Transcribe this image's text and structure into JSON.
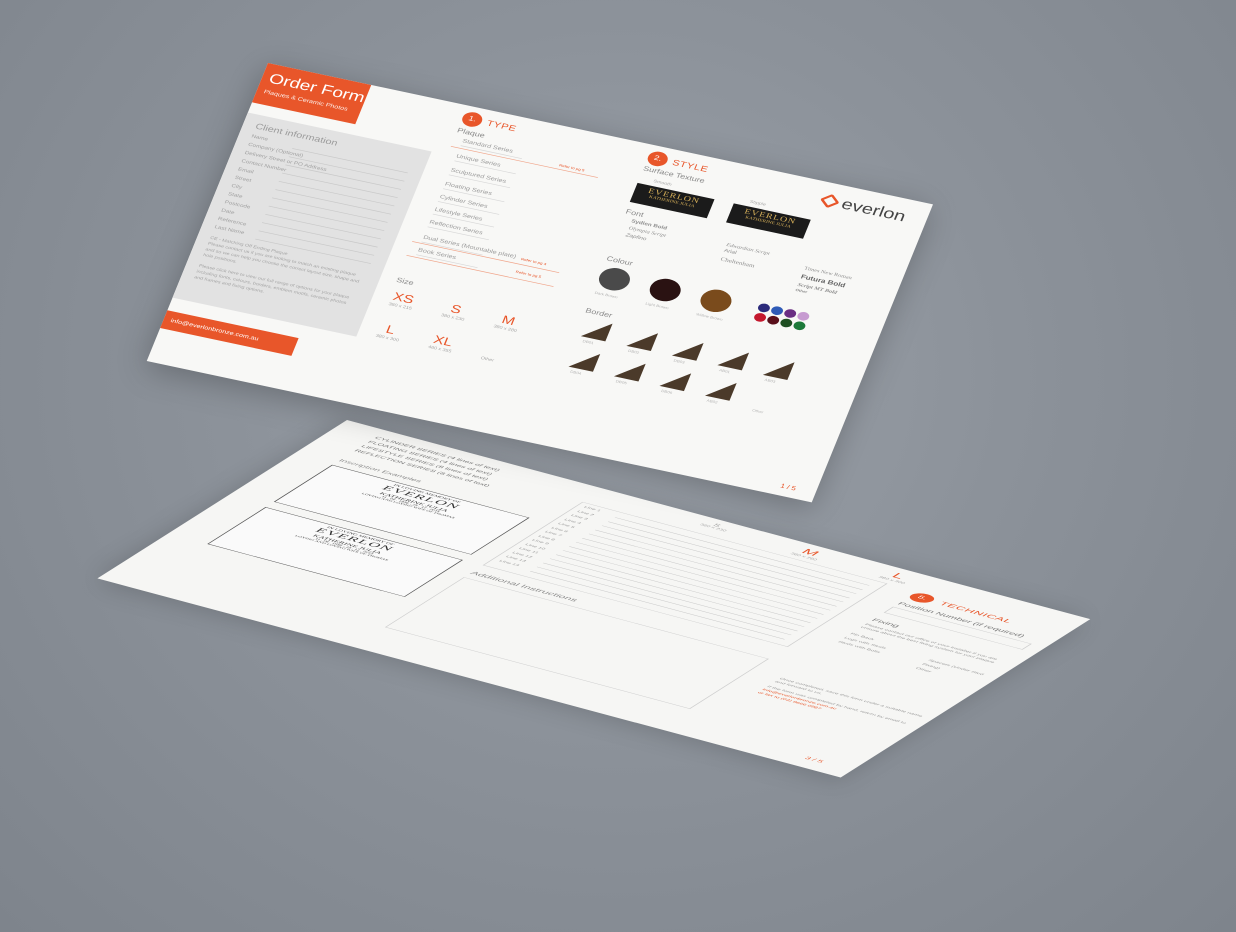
{
  "front": {
    "header": {
      "title": "Order Form",
      "subtitle": "Plaques & Ceramic Photos"
    },
    "client": {
      "title": "Client information",
      "fields": [
        "Name",
        "Company (Optional)",
        "Delivery Street or PO Address",
        "Contact Number",
        "Email",
        "Street",
        "City",
        "State",
        "Postcode",
        "Date",
        "Reference",
        "Last Name"
      ],
      "note1": "CE - Matching Off Ending Plaque",
      "note2": "Please contact us if you are looking to match an existing plaque and so we can help you choose the correct layout size, shape and hole positions.",
      "note3": "Please click here to view our full range of options for your plaque including fonts, colours, borders, emblem motifs, ceramic photos and frames and fixing options."
    },
    "footer": "info@everlonbronze.com.au",
    "type": {
      "num": "1.",
      "title": "TYPE",
      "plaque": "Plaque",
      "series": [
        "Standard Series",
        "Unique Series",
        "Sculptured Series",
        "Floating Series",
        "Cylinder Series",
        "Lifestyle Series",
        "Reflection Series",
        "Dual Series (Mountable plate)",
        "Book Series"
      ],
      "refer1": "Refer to pg 5",
      "refer2": "Refer to pg 4",
      "refer3": "Refer to pg 5"
    },
    "size": {
      "title": "Size",
      "items": [
        {
          "l": "XS",
          "d": "380 x 215"
        },
        {
          "l": "S",
          "d": "380 x 230"
        },
        {
          "l": "M",
          "d": "380 x 280"
        },
        {
          "l": "L",
          "d": "380 x 300"
        },
        {
          "l": "XL",
          "d": "460 x 355"
        }
      ],
      "other": "Other"
    },
    "style": {
      "num": "2.",
      "title": "STYLE",
      "surface": "Surface Texture",
      "smooth": "Smooth",
      "stipple": "Stipple",
      "plaque_l1": "EVERLON",
      "plaque_l2": "KATHERINE JULIA",
      "font_title": "Font",
      "fonts": [
        "Sydlen Bold",
        "Olympia Script",
        "Zapfino",
        "Edwardian Script",
        "Arial",
        "Cheltenham",
        "Times New Roman",
        "Futura Bold",
        "Script MT Bold",
        "Other"
      ],
      "colour_title": "Colour",
      "colours": [
        {
          "name": "Dark Brown",
          "hex": "#4a4a4a"
        },
        {
          "name": "Light Brown",
          "hex": "#2a1212"
        },
        {
          "name": "Willow Brown",
          "hex": "#7a4b1c"
        }
      ],
      "extra_colours": [
        "#2b2a7a",
        "#2f5bb7",
        "#6a2e83",
        "#c79bd1",
        "#c4182d",
        "#5a0f1a",
        "#1f4f22",
        "#1d7a3a"
      ],
      "border_title": "Border",
      "borders": [
        "DB01",
        "DB02",
        "DB03",
        "AB01",
        "AB03",
        "DB04",
        "DB05",
        "DB06",
        "AB02",
        "Other"
      ]
    },
    "brand": "everlon",
    "page": "1 / 5"
  },
  "back": {
    "series_list": [
      "CYLINDER SERIES (4 lines of text)",
      "FLOATING SERIES (4 lines of text)",
      "LIFESTYLE SERIES (8 lines of text)",
      "REFLECTION SERIES (8 lines of text)"
    ],
    "examples_title": "Inscription Examples",
    "ex_l1": "IN LOVING MEMORY OF",
    "ex_l2": "EVERLON",
    "ex_l3": "KATHERINE JULIA",
    "ex_l4": "11 . 06 . 1956 - 25 . 12 . 2015",
    "ex_l5": "LOVING AND LOVING WIFE OF THOMAS",
    "lines": [
      "Line 1",
      "Line 2",
      "Line 3",
      "Line 4",
      "Line 5",
      "Line 6",
      "Line 7",
      "Line 8",
      "Line 9",
      "Line 10",
      "Line 11",
      "Line 12",
      "Line 13",
      "Line 14"
    ],
    "sizes": [
      {
        "l": "S",
        "d": "380 x 230"
      },
      {
        "l": "M",
        "d": "380 x 280"
      },
      {
        "l": "L",
        "d": "380 x 300"
      }
    ],
    "additional": "Additional Instructions",
    "technical": {
      "num": "5.",
      "title": "TECHNICAL",
      "position": "Position Number (if required)"
    },
    "fixing": {
      "title": "Fixing",
      "desc": "Please contact our office or your installer if you are unsure about the best fixing system for your plaque",
      "opts": [
        "Pin Back",
        "Lugs with Studs",
        "Studs with Bolts",
        "Spacers (Under Stud Fixing)",
        "Other"
      ]
    },
    "contact": {
      "l1": "Once completed, save this form under a suitable name and forward to us.",
      "l2": "If the form was completed by hand, return by email to",
      "email": "info@everlonbronze.com.au",
      "fax": "or fax to (02) 9666 0987"
    },
    "page": "3 / 5"
  }
}
